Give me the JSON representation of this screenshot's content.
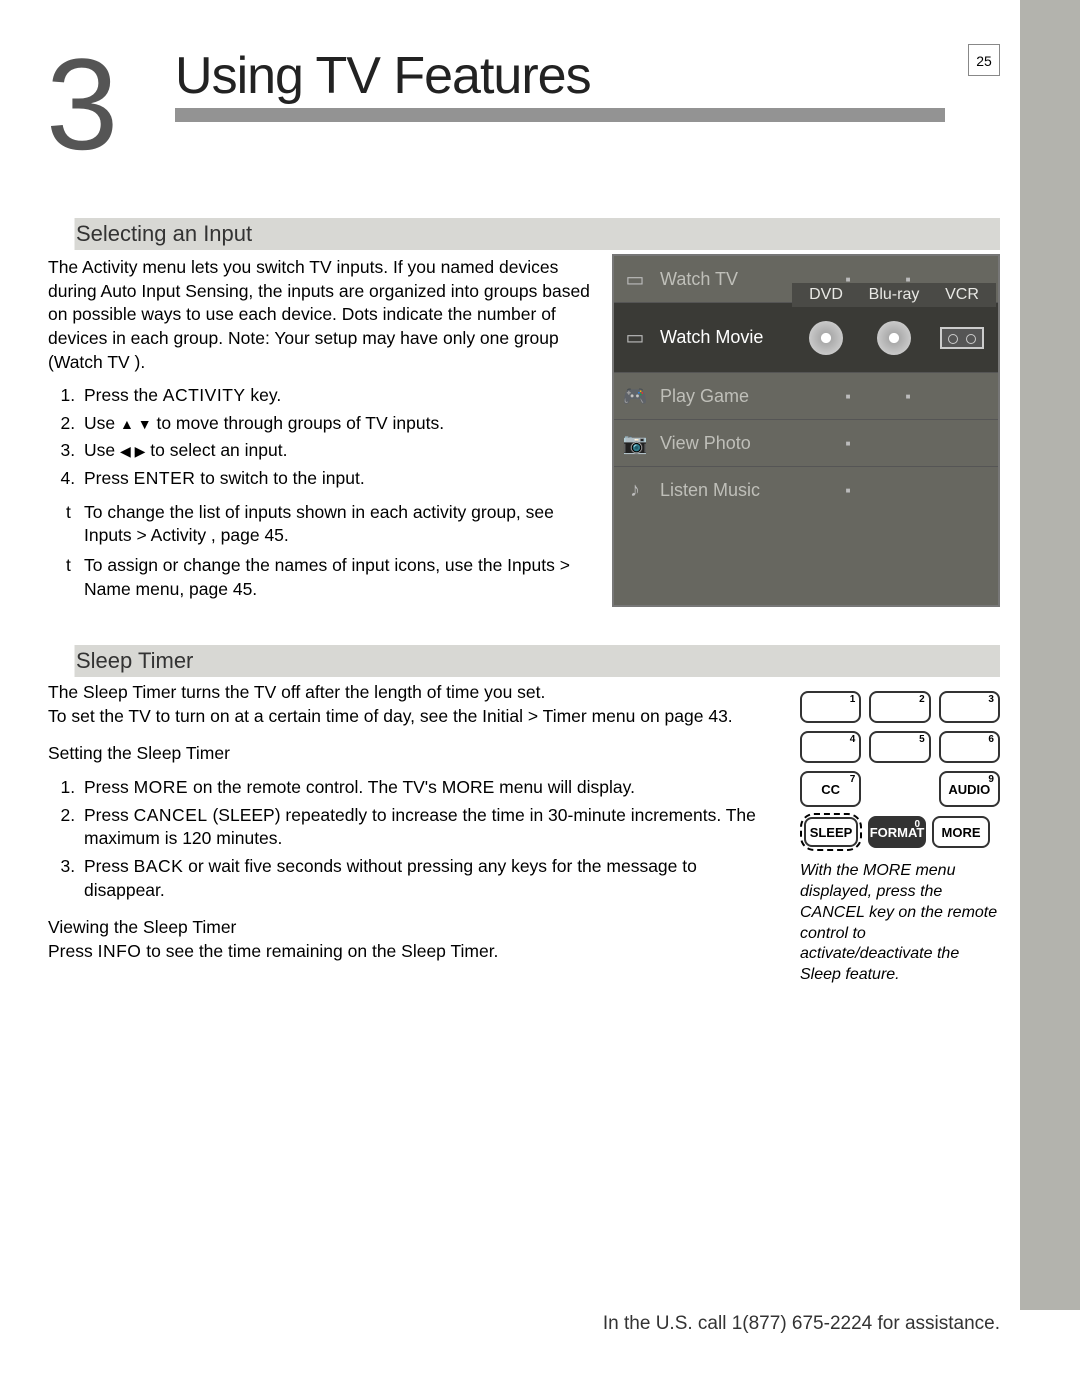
{
  "page_number": "25",
  "chapter_number": "3",
  "chapter_title": "Using TV Features",
  "section1": {
    "heading": "Selecting an Input",
    "intro": "The Activity   menu lets you switch TV inputs.  If you named devices during Auto Input Sensing, the inputs are organized into groups based on possible ways to use each device.  Dots indicate the number of devices in each group.    Note:  Your setup may have only one group (Watch TV ).",
    "steps": [
      {
        "pre": "Press the ",
        "key": "ACTIVITY",
        "post": " key."
      },
      {
        "pre": "Use ",
        "key": "▲ ▼",
        "post": " to move through groups of TV inputs."
      },
      {
        "pre": "Use ",
        "key": "◀ ▶",
        "post": " to select an input."
      },
      {
        "pre": "Press ",
        "key": "ENTER",
        "post": " to switch to the input."
      }
    ],
    "notes": [
      "To change the list of inputs shown in each activity group, see Inputs > Activity   , page 45.",
      "To assign or change the names of input icons, use the Inputs  > Name  menu, page 45."
    ],
    "activity_menu": {
      "rows": [
        {
          "icon": "tv",
          "label": "Watch TV",
          "dots": 2
        },
        {
          "icon": "movie",
          "label": "Watch Movie",
          "highlight": true,
          "sources": [
            "DVD",
            "Blu-ray",
            "VCR"
          ]
        },
        {
          "icon": "gamepad",
          "label": "Play Game",
          "dots": 2
        },
        {
          "icon": "camera",
          "label": "View Photo",
          "dots": 1
        },
        {
          "icon": "music",
          "label": "Listen Music",
          "dots": 1
        }
      ]
    }
  },
  "section2": {
    "heading": "Sleep Timer",
    "intro": "The Sleep Timer turns the TV off after the length of time you set.\nTo set the TV to turn on at a certain time of day, see the Initial > Timer   menu on page 43.",
    "sub1_heading": "Setting the Sleep Timer",
    "sub1_steps": [
      {
        "pre": "Press ",
        "key": "MORE",
        "post": " on the remote control. The TV's MORE menu will display."
      },
      {
        "pre": "Press ",
        "key": "CANCEL",
        "post": " (SLEEP) repeatedly to increase the time in 30-minute increments. The maximum is 120 minutes."
      },
      {
        "pre": "Press ",
        "key": "BACK",
        "post": " or wait five seconds without pressing any keys for the message to disappear."
      }
    ],
    "sub2_heading": "Viewing the Sleep Timer",
    "sub2_text_pre": "Press ",
    "sub2_text_key": "INFO",
    "sub2_text_post": " to see the time remaining on the Sleep Timer.",
    "remote": {
      "keys": {
        "k1": "1",
        "k2": "2",
        "k3": "3",
        "k4": "4",
        "k5": "5",
        "k6": "6",
        "k7": "7",
        "k7_label": "CC",
        "k9": "9",
        "k9_label": "AUDIO",
        "sleep": "SLEEP",
        "k0": "0",
        "k0_label": "FORMAT",
        "more": "MORE"
      },
      "caption": "With the MORE menu displayed, press the CANCEL key on the remote control to activate/deactivate the Sleep feature."
    }
  },
  "footer": "In the U.S. call 1(877) 675-2224 for assistance."
}
